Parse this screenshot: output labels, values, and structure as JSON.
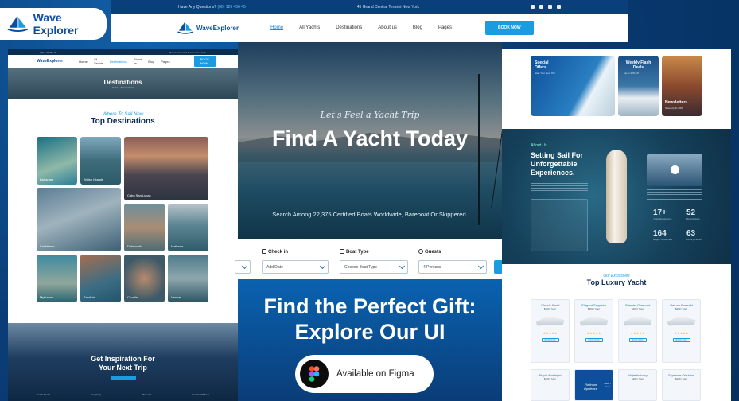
{
  "brand": {
    "name": "Wave Explorer",
    "short": "WaveExplorer"
  },
  "topbar": {
    "question": "Have Any Questions?",
    "phone": "(00) 123 456 45",
    "address": "45 Grand Central Termini New York"
  },
  "nav": {
    "items": [
      "Home",
      "All Yachts",
      "Destinations",
      "About us",
      "Blog",
      "Pages"
    ],
    "book": "BOOK NOW"
  },
  "left": {
    "hero_title": "Destinations",
    "hero_crumb": "Home  ·  Destinations",
    "script": "Where To Sail Now",
    "title": "Top Destinations",
    "tiles": [
      "Bahamas",
      "British Islands",
      "Cabo San Lucas",
      "Caribbean",
      "Dubrovnik",
      "Mallorca",
      "Mykonos",
      "Sardinia",
      "Croatia",
      "Venice"
    ],
    "insp_title_1": "Get Inspiration For",
    "insp_title_2": "Your Next Trip",
    "footer": [
      "Get In Touch",
      "Company",
      "Discover",
      "Contact With Us"
    ]
  },
  "hero": {
    "script": "Let's Feel a Yacht Trip",
    "title": "Find A Yacht Today",
    "sub": "Search Among 22,375 Certified Boats Worldwide, Bareboat Or Skippered."
  },
  "search": {
    "checkin_label": "Check in",
    "checkin_value": "Add Date",
    "boat_label": "Boat Type",
    "boat_value": "Choose Boat Type",
    "guests_label": "Guests",
    "guests_value": "4 Persons"
  },
  "gift": {
    "line1": "Find the Perfect Gift:",
    "line2": "Explore Our UI",
    "figma": "Available on Figma"
  },
  "right": {
    "offers": [
      {
        "title": "Special Offers",
        "sub": "Start Your Next Trip"
      },
      {
        "title": "Weekly Flash Deals",
        "sub": "up to 20% off"
      },
      {
        "title": "Newsletters",
        "sub": "Save Up To 30%"
      }
    ],
    "sail_script": "About Us",
    "sail_title_1": "Setting Sail For",
    "sail_title_2": "Unforgettable",
    "sail_title_3": "Experiences.",
    "stats": [
      {
        "value": "17+",
        "label": "Years Experience"
      },
      {
        "value": "52",
        "label": "Destinations"
      },
      {
        "value": "164",
        "label": "Happy Customers"
      },
      {
        "value": "63",
        "label": "Luxury Yachts"
      }
    ],
    "lux_script": "Our Exclusives",
    "lux_title": "Top Luxury Yacht",
    "yachts": [
      "Classic Pearl",
      "Elegant Sapphire",
      "Premier Diamond",
      "Deluxe Emerald"
    ],
    "yacht_price": "$200 / hour",
    "yacht_btn": "BOOK NOW",
    "yachts2": [
      "Royal Amethyst",
      "Platinum Opulence",
      "Majestic Ivory",
      "Supreme Obsidian"
    ]
  }
}
